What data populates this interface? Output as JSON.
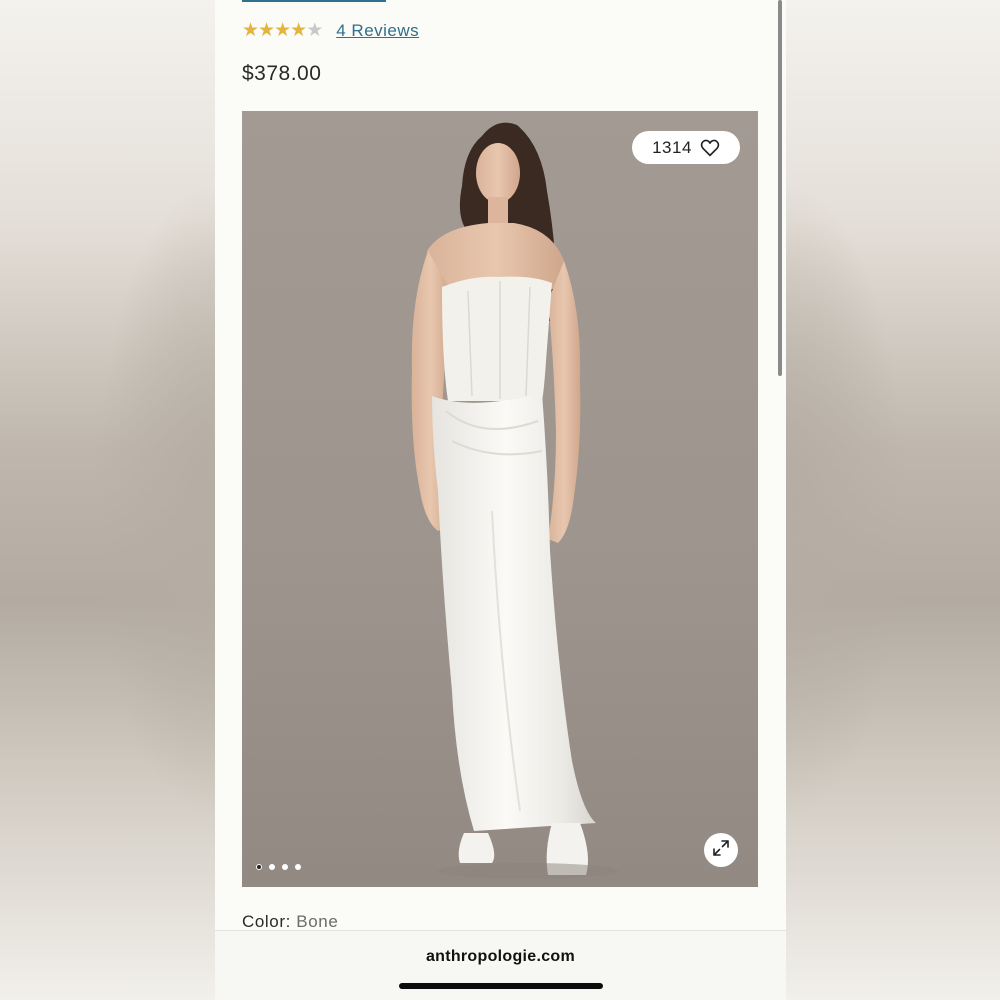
{
  "product": {
    "rating": 4,
    "rating_max": 5,
    "reviews_label": "4 Reviews",
    "price": "$378.00"
  },
  "gallery": {
    "favorites_count": "1314",
    "slide_count": 4,
    "active_slide": 1
  },
  "color": {
    "label": "Color:",
    "value": "Bone"
  },
  "browser": {
    "url": "anthropologie.com"
  },
  "icons": {
    "favorite": "heart-icon",
    "expand": "expand-arrows-icon",
    "star": "star-icon"
  },
  "colors": {
    "link": "#2f6f8f",
    "star_filled": "#e5b43c",
    "star_empty": "#c9c9c9"
  }
}
